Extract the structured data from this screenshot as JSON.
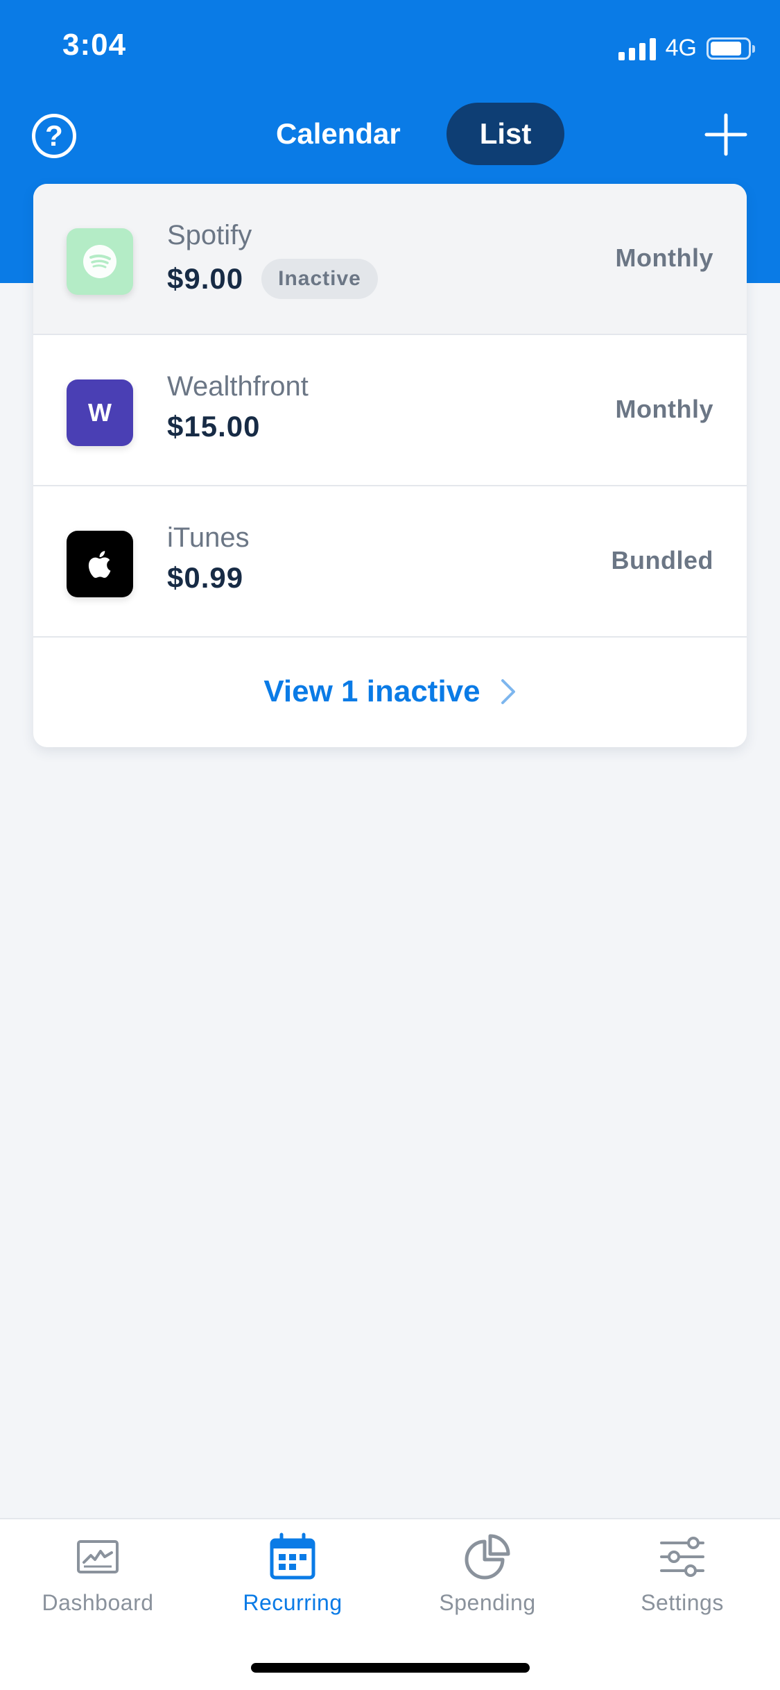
{
  "status_bar": {
    "time": "3:04",
    "network": "4G"
  },
  "header": {
    "segments": [
      {
        "label": "Calendar",
        "active": false
      },
      {
        "label": "List",
        "active": true
      }
    ],
    "accent_color": "#0a7be6"
  },
  "subscriptions": [
    {
      "name": "Spotify",
      "amount": "$9.00",
      "badge": "Inactive",
      "frequency": "Monthly",
      "logo": "spotify-logo",
      "logo_color": "#b4ecc6"
    },
    {
      "name": "Wealthfront",
      "amount": "$15.00",
      "frequency": "Monthly",
      "logo": "wealthfront-logo",
      "logo_letter": "W",
      "logo_color": "#4a3fb4"
    },
    {
      "name": "iTunes",
      "amount": "$0.99",
      "frequency": "Bundled",
      "logo": "apple-logo",
      "logo_color": "#000000"
    }
  ],
  "view_inactive_label": "View 1 inactive",
  "tabbar": {
    "tabs": [
      {
        "label": "Dashboard",
        "icon": "chart-icon",
        "active": false
      },
      {
        "label": "Recurring",
        "icon": "calendar-icon",
        "active": true
      },
      {
        "label": "Spending",
        "icon": "pie-chart-icon",
        "active": false
      },
      {
        "label": "Settings",
        "icon": "sliders-icon",
        "active": false
      }
    ]
  }
}
